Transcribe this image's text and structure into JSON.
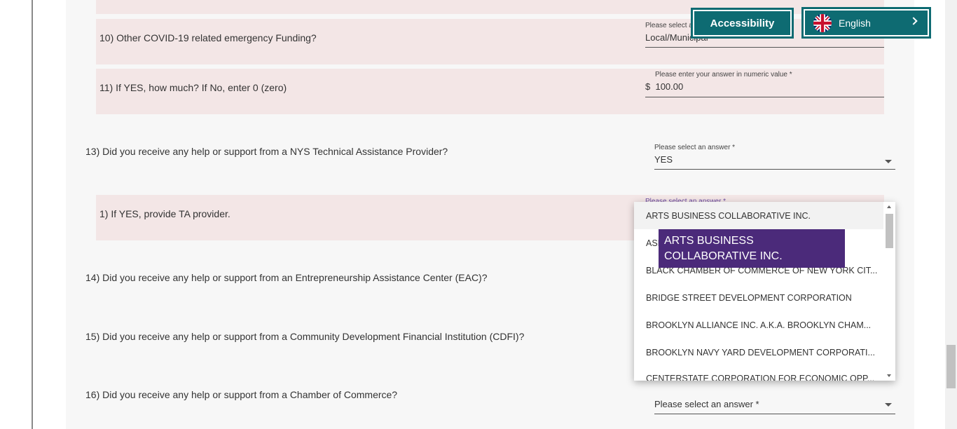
{
  "questions": {
    "q10": {
      "text": "10) Other COVID-19 related emergency Funding?",
      "label": "Please select a",
      "value": "Local/Municipal"
    },
    "q11": {
      "text": "11) If YES, how much? If No, enter 0 (zero)",
      "label": "Please enter your answer in numeric value *",
      "prefix": "$",
      "value": "100.00"
    },
    "q13": {
      "text": "13) Did you receive any help or support from a NYS Technical Assistance Provider?",
      "label": "Please select an answer *",
      "value": "YES"
    },
    "q13_1": {
      "text": "1) If YES, provide TA provider.",
      "label": "Please select an answer *"
    },
    "q14": {
      "text": "14) Did you receive any help or support from an Entrepreneurship Assistance Center (EAC)?"
    },
    "q15": {
      "text": "15) Did you receive any help or support from a Community Development Financial Institution (CDFI)?"
    },
    "q16": {
      "text": "16) Did you receive any help or support from a Chamber of Commerce?",
      "placeholder": "Please select an answer *"
    }
  },
  "header": {
    "accessibility_label": "Accessibility",
    "language_label": "English"
  },
  "dropdown": {
    "options": [
      "ARTS BUSINESS COLLABORATIVE INC.",
      "ASI",
      "BLACK CHAMBER OF COMMERCE OF NEW YORK CIT...",
      "BRIDGE STREET DEVELOPMENT CORPORATION",
      "BROOKLYN ALLIANCE INC. A.K.A. BROOKLYN CHAM...",
      "BROOKLYN NAVY YARD DEVELOPMENT CORPORATI...",
      "CENTERSTATE CORPORATION FOR ECONOMIC OPP..."
    ],
    "tooltip": "ARTS BUSINESS COLLABORATIVE INC."
  },
  "colors": {
    "accent": "#0e6b72",
    "tooltip": "#4b2a7a",
    "card": "#f3e6e6"
  },
  "icons": {
    "flag": "uk-flag-icon",
    "chevron": "chevron-right-icon"
  }
}
